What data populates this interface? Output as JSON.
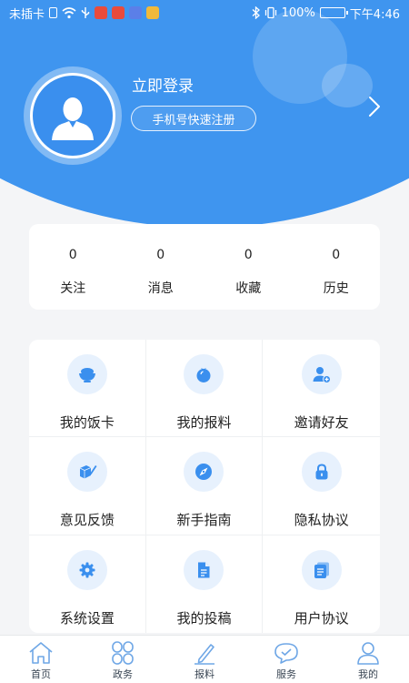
{
  "status_bar": {
    "carrier": "未插卡",
    "battery": "100%",
    "time": "下午4:46",
    "battery_level": 1.0
  },
  "profile": {
    "login_label": "立即登录",
    "register_label": "手机号快速注册"
  },
  "stats": [
    {
      "value": "0",
      "label": "关注"
    },
    {
      "value": "0",
      "label": "消息"
    },
    {
      "value": "0",
      "label": "收藏"
    },
    {
      "value": "0",
      "label": "历史"
    }
  ],
  "menu": [
    {
      "label": "我的饭卡",
      "icon": "bowl-icon"
    },
    {
      "label": "我的报料",
      "icon": "tomato-icon"
    },
    {
      "label": "邀请好友",
      "icon": "add-user-icon"
    },
    {
      "label": "意见反馈",
      "icon": "cube-pencil-icon"
    },
    {
      "label": "新手指南",
      "icon": "compass-icon"
    },
    {
      "label": "隐私协议",
      "icon": "lock-icon"
    },
    {
      "label": "系统设置",
      "icon": "gear-icon"
    },
    {
      "label": "我的投稿",
      "icon": "document-icon"
    },
    {
      "label": "用户协议",
      "icon": "notebook-icon"
    }
  ],
  "bottom_nav": [
    {
      "label": "首页",
      "icon": "home-icon"
    },
    {
      "label": "政务",
      "icon": "clover-icon"
    },
    {
      "label": "报料",
      "icon": "pen-icon"
    },
    {
      "label": "服务",
      "icon": "service-icon"
    },
    {
      "label": "我的",
      "icon": "person-icon"
    }
  ],
  "colors": {
    "header_blue": "#3f95ef",
    "icon_blue": "#3a8fee",
    "icon_bg": "#e7f1fd",
    "nav_icon": "#6fa7e6"
  }
}
